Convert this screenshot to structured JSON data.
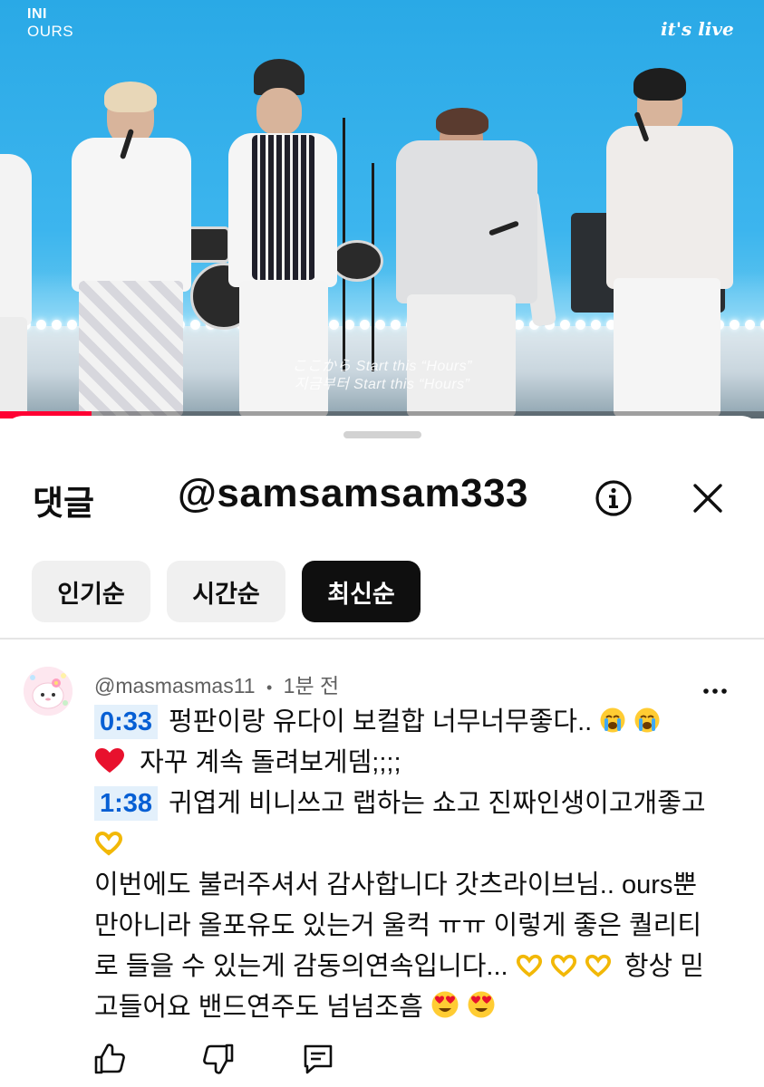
{
  "video": {
    "brand_top_left": "INI",
    "brand_top_left_sub": "OURS",
    "brand_top_right": "it's live",
    "subtitle_line1": "ここから Start this “Hours”",
    "subtitle_line2": "지금부터 Start this “Hours”",
    "progress_fraction": 0.12,
    "accent_color": "#ff0033"
  },
  "sheet": {
    "title": "댓글",
    "handle": "@samsamsam333",
    "info_icon": "info-icon",
    "close_icon": "close-icon"
  },
  "sort_chips": [
    {
      "label": "인기순",
      "active": false
    },
    {
      "label": "시간순",
      "active": false
    },
    {
      "label": "최신순",
      "active": true
    }
  ],
  "comment": {
    "author": "@masmasmas11",
    "separator": "•",
    "time": "1분 전",
    "timestamp_1": "0:33",
    "line1_text": "펑판이랑 유다이 보컬합 너무너무좋다..",
    "line2_text": "자꾸 계속 돌려보게뎀;;;;",
    "timestamp_2": "1:38",
    "line3_text": "귀엽게 비니쓰고 랩하는 쇼고 진짜인생이고개좋고",
    "line5_text": "이번에도 불러주셔서 감사합니다 갓츠라이브님.. ours뿐",
    "line6_text": "만아니라 올포유도 있는거 울컥 ㅠㅠ 이렇게 좋은 퀄리티",
    "line7_text": "로 들을 수 있는게 감동의연속입니다...",
    "line7_tail": "항상 믿",
    "line8_text": "고들어요 밴드연주도 넘넘조흠",
    "timestamp_color": "#065fd4",
    "emoji_names": [
      "loudly-crying-face",
      "red-heart",
      "heart-hands",
      "smiling-face-with-heart-eyes"
    ]
  },
  "actions": [
    "like-icon",
    "dislike-icon",
    "reply-icon"
  ]
}
